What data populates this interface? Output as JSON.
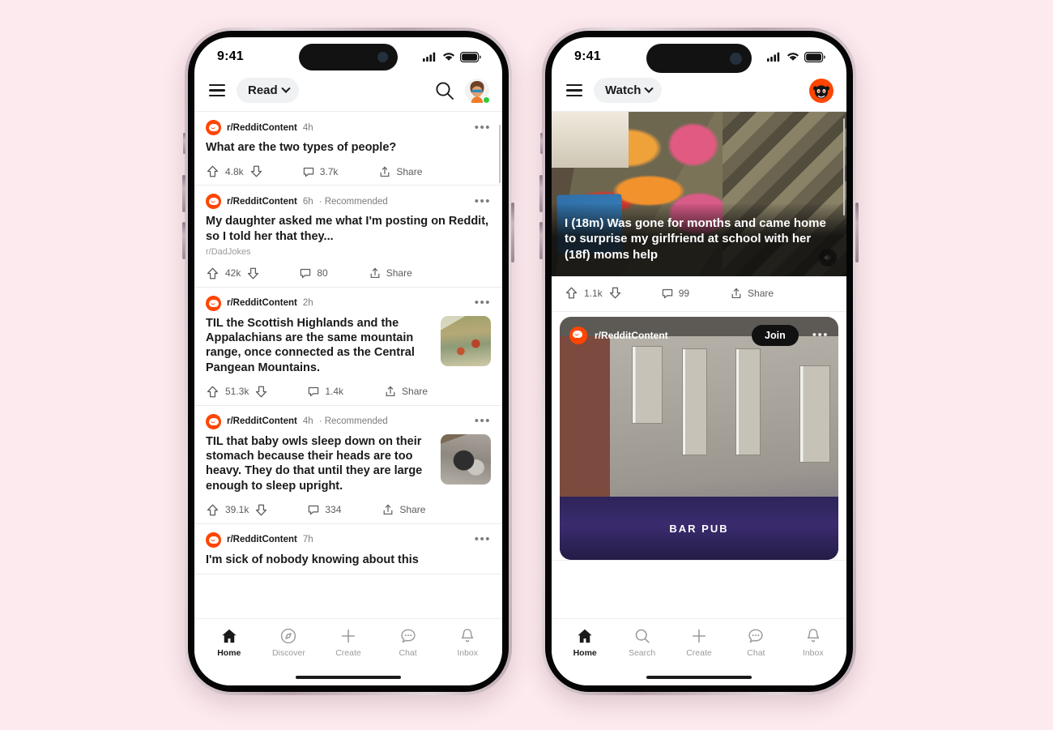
{
  "canvas": {
    "background": "#fceaee"
  },
  "brand": {
    "reddit_orange": "#ff4500",
    "text_dark": "#1a1a1a",
    "muted": "#7c7c7c"
  },
  "phone_left": {
    "status": {
      "time": "9:41",
      "cellular": "cellular-icon",
      "wifi": "wifi-icon",
      "battery": "battery-icon"
    },
    "header": {
      "menu": "hamburger-icon",
      "feed_selector": "Read",
      "chevron": "chevron-down-icon",
      "search": "search-icon",
      "avatar": "user-avatar"
    },
    "posts": [
      {
        "subreddit": "r/RedditContent",
        "age": "4h",
        "recommended": "",
        "title": "What are the two types of people?",
        "crosspost": "",
        "thumb": "",
        "upvotes": "4.8k",
        "comments": "3.7k",
        "share": "Share"
      },
      {
        "subreddit": "r/RedditContent",
        "age": "6h",
        "recommended": "· Recommended",
        "title": "My daughter asked me what I'm posting on Reddit, so I told her that they...",
        "crosspost": "r/DadJokes",
        "thumb": "",
        "upvotes": "42k",
        "comments": "80",
        "share": "Share"
      },
      {
        "subreddit": "r/RedditContent",
        "age": "2h",
        "recommended": "",
        "title": "TIL the Scottish Highlands and the Appalachians are the same mountain range, once connected as the Central Pangean Mountains.",
        "crosspost": "",
        "thumb": "mountain-thumbnail",
        "upvotes": "51.3k",
        "comments": "1.4k",
        "share": "Share"
      },
      {
        "subreddit": "r/RedditContent",
        "age": "4h",
        "recommended": "· Recommended",
        "title": "TIL that baby owls sleep down on their stomach because their heads are too heavy. They do that until they are large enough to sleep upright.",
        "crosspost": "",
        "thumb": "owl-thumbnail",
        "upvotes": "39.1k",
        "comments": "334",
        "share": "Share"
      },
      {
        "subreddit": "r/RedditContent",
        "age": "7h",
        "recommended": "",
        "title": "I'm sick of nobody knowing about this",
        "crosspost": "",
        "thumb": "",
        "upvotes": "",
        "comments": "",
        "share": ""
      }
    ],
    "bottom_nav": [
      {
        "label": "Home",
        "icon": "home-icon",
        "active": true
      },
      {
        "label": "Discover",
        "icon": "compass-icon",
        "active": false
      },
      {
        "label": "Create",
        "icon": "plus-icon",
        "active": false
      },
      {
        "label": "Chat",
        "icon": "chat-bubble-icon",
        "active": false
      },
      {
        "label": "Inbox",
        "icon": "bell-icon",
        "active": false
      }
    ]
  },
  "phone_right": {
    "status": {
      "time": "9:41",
      "cellular": "cellular-icon",
      "wifi": "wifi-icon",
      "battery": "battery-icon"
    },
    "header": {
      "menu": "hamburger-icon",
      "feed_selector": "Watch",
      "chevron": "chevron-down-icon",
      "avatar": "snoo-avatar"
    },
    "videos": [
      {
        "caption": "I (18m) Was gone for months and came home to surprise my girlfriend at school with her (18f) moms help",
        "sound": "speaker-icon",
        "upvotes": "1.1k",
        "comments": "99",
        "share": "Share",
        "subreddit": "",
        "join": ""
      },
      {
        "caption": "",
        "sound": "",
        "upvotes": "",
        "comments": "",
        "share": "",
        "subreddit": "r/RedditContent",
        "join": "Join",
        "sign_text": "BAR  PUB"
      }
    ],
    "bottom_nav": [
      {
        "label": "Home",
        "icon": "home-icon",
        "active": true
      },
      {
        "label": "Search",
        "icon": "search-icon",
        "active": false
      },
      {
        "label": "Create",
        "icon": "plus-icon",
        "active": false
      },
      {
        "label": "Chat",
        "icon": "chat-bubble-icon",
        "active": false
      },
      {
        "label": "Inbox",
        "icon": "bell-icon",
        "active": false
      }
    ]
  }
}
